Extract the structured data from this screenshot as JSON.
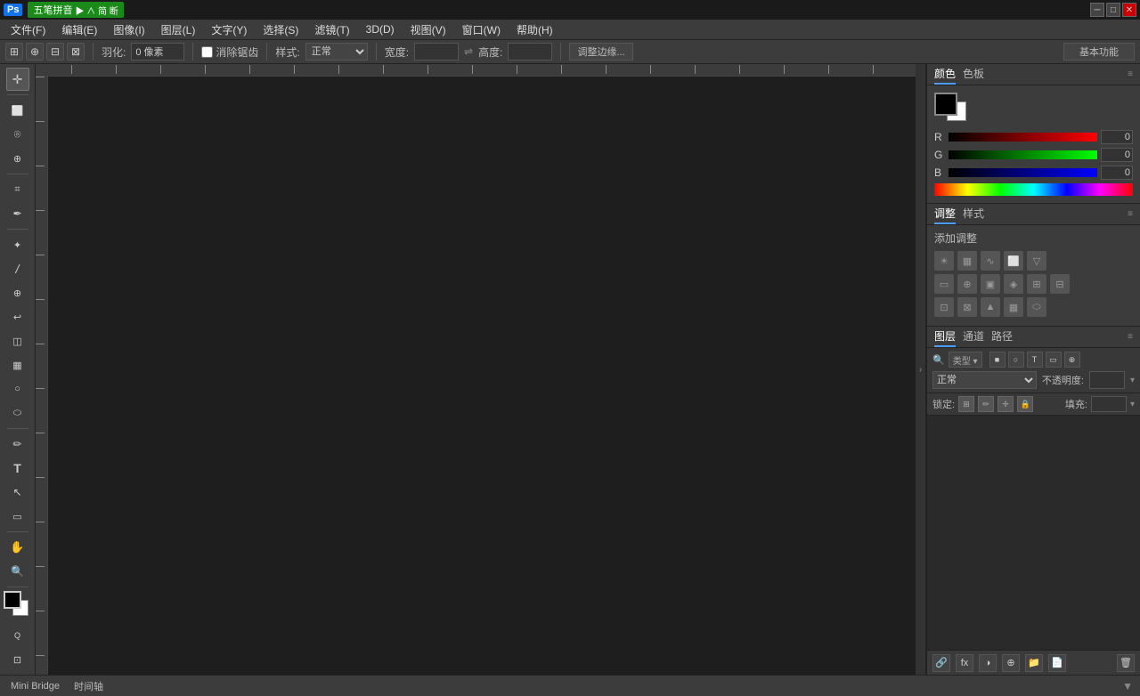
{
  "titlebar": {
    "ps_logo": "Ps",
    "ime_label": "五笔拼音",
    "ime_icons": "▶ ∧ 简 断",
    "btn_minimize": "─",
    "btn_restore": "□",
    "btn_close": "✕"
  },
  "menubar": {
    "items": [
      {
        "label": "文件(F)"
      },
      {
        "label": "编辑(E)"
      },
      {
        "label": "图像(I)"
      },
      {
        "label": "图层(L)"
      },
      {
        "label": "文字(Y)"
      },
      {
        "label": "选择(S)"
      },
      {
        "label": "滤镜(T)"
      },
      {
        "label": "3D(D)"
      },
      {
        "label": "视图(V)"
      },
      {
        "label": "窗口(W)"
      },
      {
        "label": "帮助(H)"
      }
    ]
  },
  "optionsbar": {
    "feather_label": "羽化:",
    "feather_value": "0 像素",
    "anti_alias_label": "消除锯齿",
    "style_label": "样式:",
    "style_value": "正常",
    "width_label": "宽度:",
    "width_value": "",
    "height_label": "高度:",
    "height_value": "",
    "adjust_btn": "调整边缘...",
    "workspace_label": "基本功能"
  },
  "toolbar": {
    "tools": [
      {
        "name": "move",
        "icon": "✛"
      },
      {
        "name": "selection-rect",
        "icon": "⬜"
      },
      {
        "name": "selection-lasso",
        "icon": "⌾"
      },
      {
        "name": "crop",
        "icon": "⌗"
      },
      {
        "name": "eyedropper",
        "icon": "✒"
      },
      {
        "name": "healing",
        "icon": "✦"
      },
      {
        "name": "brush",
        "icon": "/"
      },
      {
        "name": "clone",
        "icon": "⊕"
      },
      {
        "name": "eraser",
        "icon": "◫"
      },
      {
        "name": "gradient",
        "icon": "▦"
      },
      {
        "name": "dodge",
        "icon": "○"
      },
      {
        "name": "pen",
        "icon": "✏"
      },
      {
        "name": "type",
        "icon": "T"
      },
      {
        "name": "path-selection",
        "icon": "↖"
      },
      {
        "name": "shape",
        "icon": "▭"
      },
      {
        "name": "hand",
        "icon": "✋"
      },
      {
        "name": "zoom",
        "icon": "🔍"
      },
      {
        "name": "eyedropper2",
        "icon": "◈"
      },
      {
        "name": "note",
        "icon": "⊞"
      }
    ],
    "foreground_color": "#000000",
    "background_color": "#ffffff",
    "quick-mask": "Q",
    "screen-mode": "⊡",
    "frame-mode": "⊟"
  },
  "color_panel": {
    "tab_color": "颜色",
    "tab_swatches": "色板",
    "r_label": "R",
    "r_value": "0",
    "g_label": "G",
    "g_value": "0",
    "b_label": "B",
    "b_value": "0"
  },
  "adjust_panel": {
    "tab_adjust": "调整",
    "tab_styles": "样式",
    "add_label": "添加调整"
  },
  "layers_panel": {
    "tab_layers": "图层",
    "tab_channels": "通道",
    "tab_paths": "路径",
    "filter_placeholder": "类型",
    "mode_label": "正常",
    "opacity_label": "不透明度:",
    "lock_label": "锁定:",
    "fill_label": "填充:"
  },
  "bottombar": {
    "tab_mini_bridge": "Mini Bridge",
    "tab_timeline": "时间轴",
    "collapse_icon": "▼"
  }
}
